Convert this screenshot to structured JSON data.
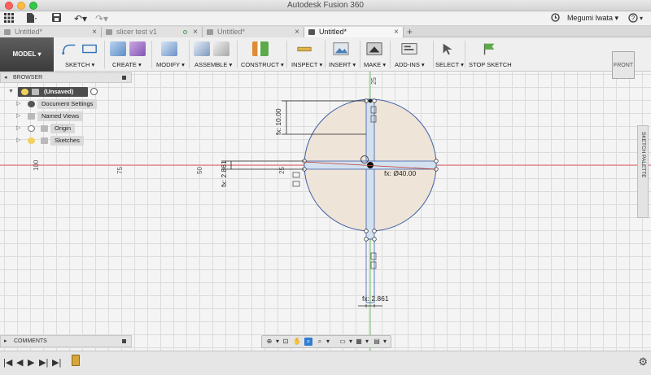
{
  "window": {
    "title": "Autodesk Fusion 360"
  },
  "user": {
    "name": "Megumi Iwata",
    "help_label": "?"
  },
  "tabs": [
    {
      "label": "Untitled*"
    },
    {
      "label": "slicer test v1"
    },
    {
      "label": "Untitled*"
    },
    {
      "label": "Untitled*"
    }
  ],
  "toolbar": {
    "workspace": "MODEL ▾",
    "groups": [
      {
        "label": "SKETCH ▾"
      },
      {
        "label": "CREATE ▾"
      },
      {
        "label": "MODIFY ▾"
      },
      {
        "label": "ASSEMBLE ▾"
      },
      {
        "label": "CONSTRUCT ▾"
      },
      {
        "label": "INSPECT ▾"
      },
      {
        "label": "INSERT ▾"
      },
      {
        "label": "MAKE ▾"
      },
      {
        "label": "ADD-INS ▾"
      },
      {
        "label": "SELECT ▾"
      },
      {
        "label": "STOP SKETCH"
      }
    ]
  },
  "browser": {
    "title": "BROWSER",
    "root": "(Unsaved)",
    "items": [
      {
        "label": "Document Settings"
      },
      {
        "label": "Named Views"
      },
      {
        "label": "Origin"
      },
      {
        "label": "Sketches"
      }
    ]
  },
  "viewcube": {
    "label": "FRONT"
  },
  "palette": {
    "label": "SKETCH PALETTE"
  },
  "comments": {
    "title": "COMMENTS"
  },
  "sketch": {
    "dim_top": "fx: 10.00",
    "dim_left": "fx: 2.861",
    "dim_diameter": "fx: Ø40.00",
    "dim_bottom": "fx: 2.861",
    "ruler_h": [
      "100",
      "75",
      "50",
      "25"
    ],
    "ruler_v": [
      "25"
    ]
  },
  "colors": {
    "circle_fill": "#efe4d8",
    "sketch_line": "#3e5fa8",
    "axis_red": "#e45b5b",
    "axis_green": "#6fc26f",
    "selection": "#2f7cd3"
  }
}
